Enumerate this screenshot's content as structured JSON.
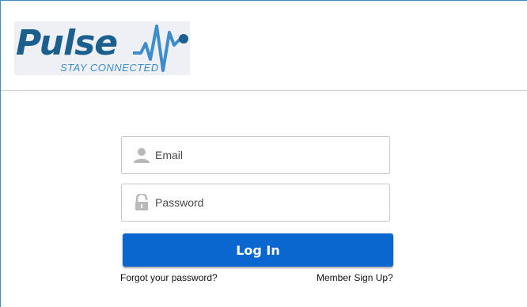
{
  "brand": {
    "name": "Pulse",
    "tagline": "STAY CONNECTED",
    "colors": {
      "primary": "#1b5f8e",
      "secondary": "#3d8ccc",
      "button": "#0a67cf"
    }
  },
  "form": {
    "email": {
      "placeholder": "Email",
      "value": "",
      "icon": "user-icon"
    },
    "password": {
      "placeholder": "Password",
      "value": "",
      "icon": "lock-icon"
    },
    "login_label": "Log In",
    "forgot_label": "Forgot your password?",
    "signup_label": "Member Sign Up?"
  }
}
